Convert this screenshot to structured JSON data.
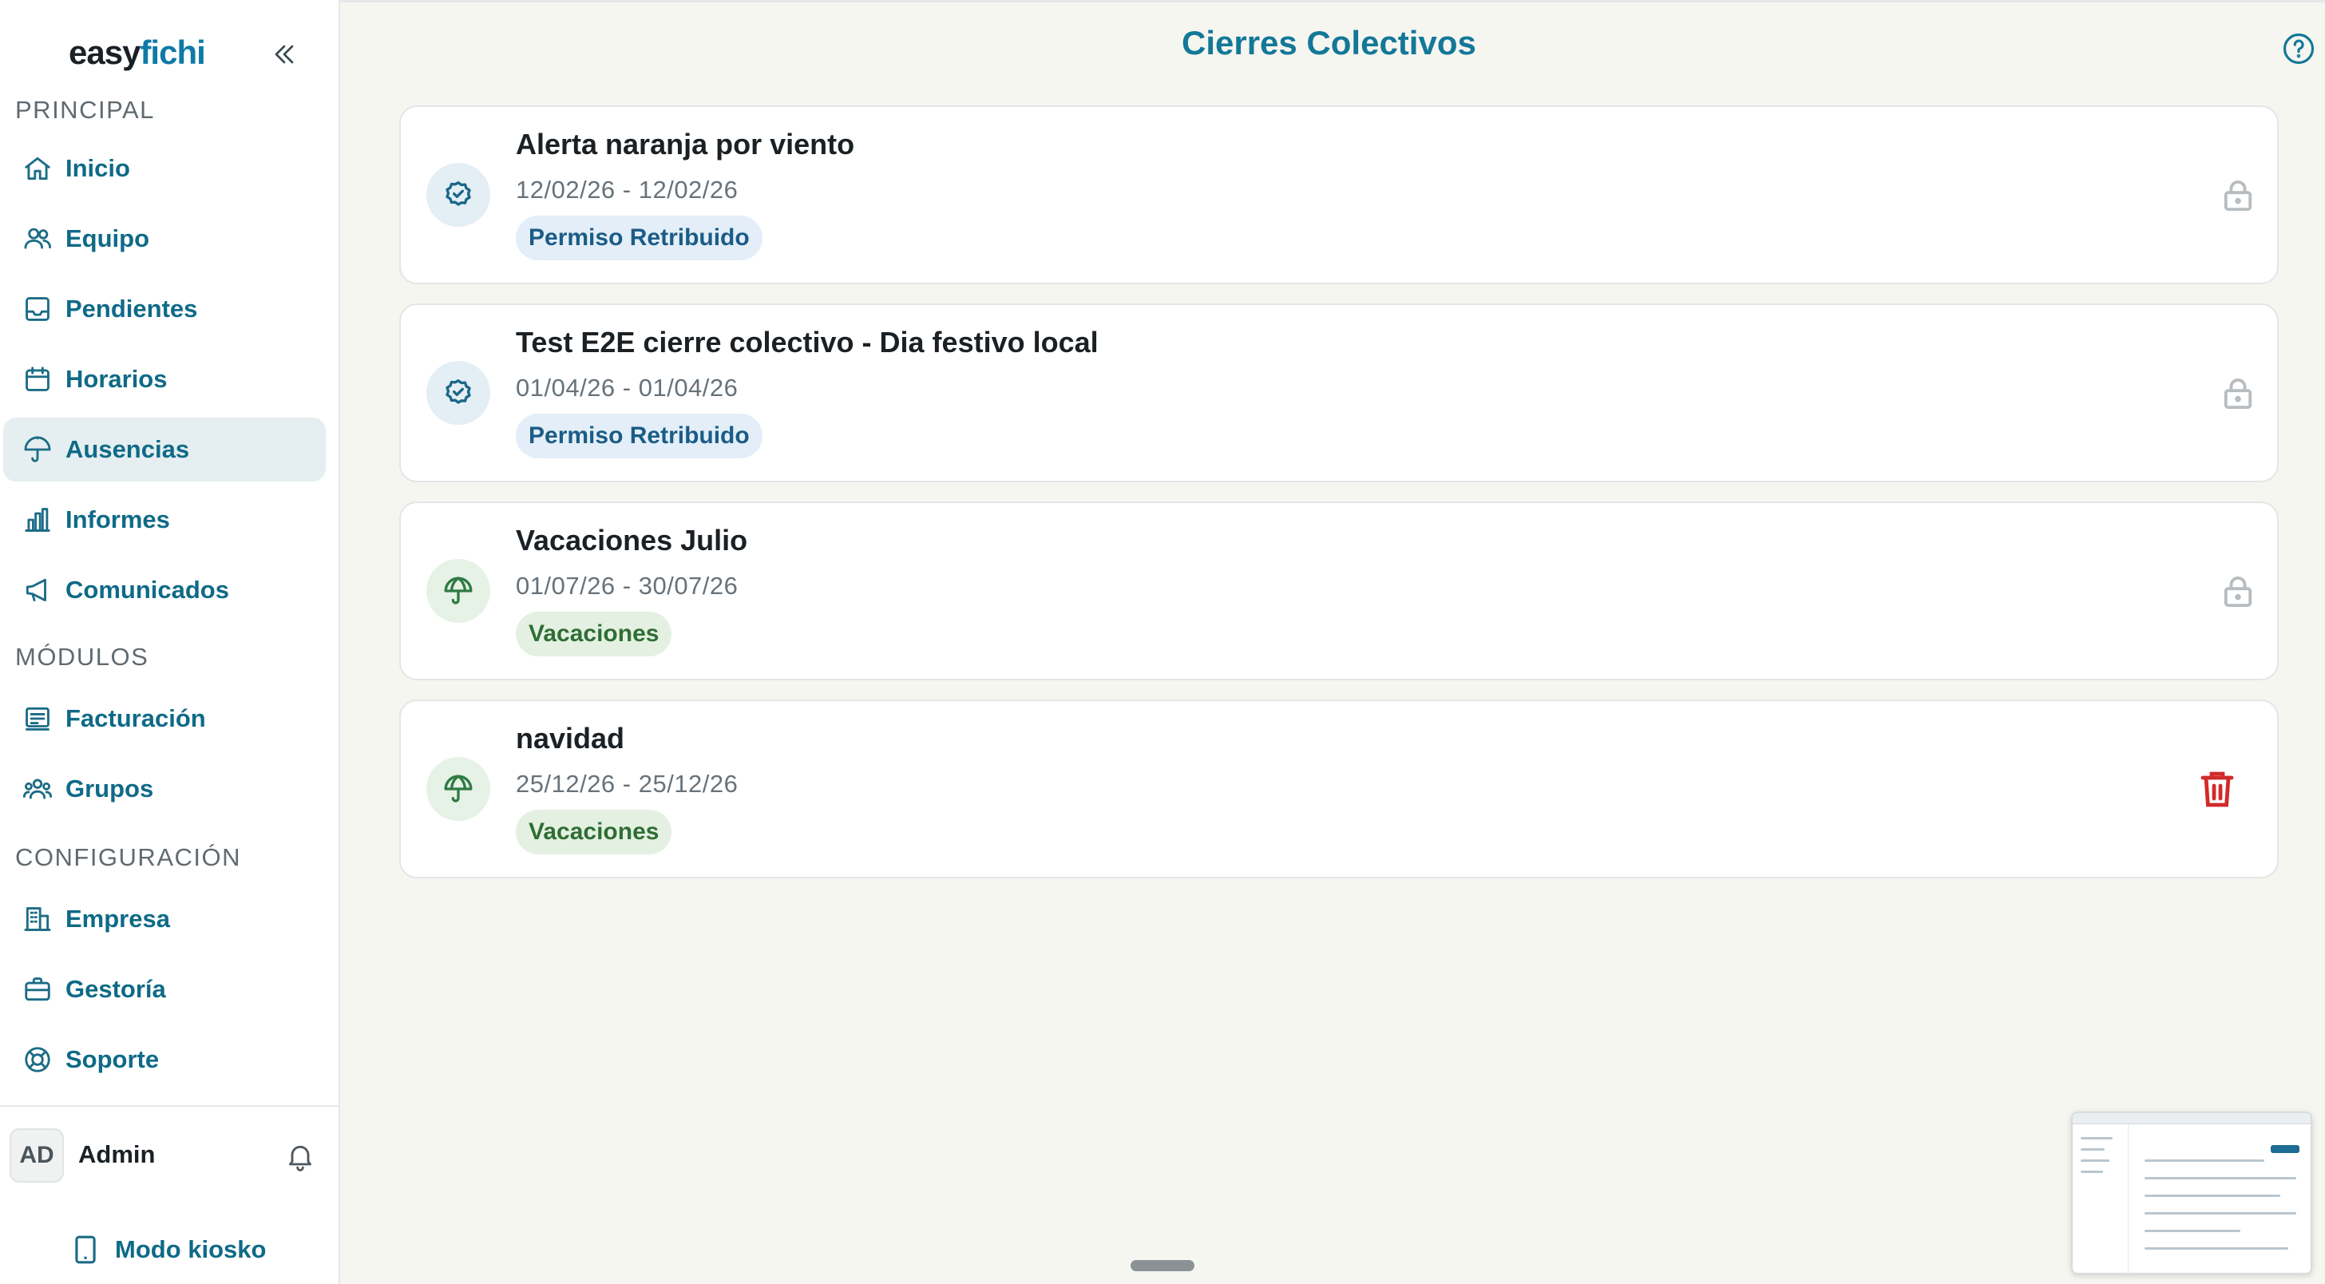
{
  "brand": {
    "part1": "easy",
    "part2": "fichi"
  },
  "sidebar": {
    "sections": [
      {
        "title": "PRINCIPAL"
      },
      {
        "title": "MÓDULOS"
      },
      {
        "title": "CONFIGURACIÓN"
      }
    ],
    "items": [
      {
        "label": "Inicio",
        "icon": "home-icon"
      },
      {
        "label": "Equipo",
        "icon": "users-icon"
      },
      {
        "label": "Pendientes",
        "icon": "inbox-icon"
      },
      {
        "label": "Horarios",
        "icon": "calendar-icon"
      },
      {
        "label": "Ausencias",
        "icon": "umbrella-icon",
        "active": true
      },
      {
        "label": "Informes",
        "icon": "bar-chart-icon"
      },
      {
        "label": "Comunicados",
        "icon": "megaphone-icon"
      },
      {
        "label": "Facturación",
        "icon": "receipt-icon"
      },
      {
        "label": "Grupos",
        "icon": "group-icon"
      },
      {
        "label": "Empresa",
        "icon": "building-icon"
      },
      {
        "label": "Gestoría",
        "icon": "briefcase-icon"
      },
      {
        "label": "Soporte",
        "icon": "lifebuoy-icon"
      }
    ],
    "user": {
      "initials": "AD",
      "name": "Admin"
    },
    "kiosk_label": "Modo kiosko"
  },
  "page": {
    "title": "Cierres Colectivos"
  },
  "closures": [
    {
      "title": "Alerta naranja por viento",
      "dates": "12/02/26 - 12/02/26",
      "type": "Permiso Retribuido",
      "icon": "badge-check-icon",
      "action": "lock-icon"
    },
    {
      "title": "Test E2E cierre colectivo - Dia festivo local",
      "dates": "01/04/26 - 01/04/26",
      "type": "Permiso Retribuido",
      "icon": "badge-check-icon",
      "action": "lock-icon"
    },
    {
      "title": "Vacaciones Julio",
      "dates": "01/07/26 - 30/07/26",
      "type": "Vacaciones",
      "icon": "umbrella-icon",
      "action": "lock-icon"
    },
    {
      "title": "navidad",
      "dates": "25/12/26 - 25/12/26",
      "type": "Vacaciones",
      "icon": "umbrella-icon",
      "action": "trash-icon"
    }
  ],
  "colors": {
    "accent": "#137898",
    "nav_text": "#0f6a87",
    "active_bg": "#e5eef0",
    "paid_badge_bg": "#e3eef8",
    "vacation_badge_bg": "#e4f1e2",
    "danger": "#d12a2a",
    "background": "#f6f6f1"
  }
}
